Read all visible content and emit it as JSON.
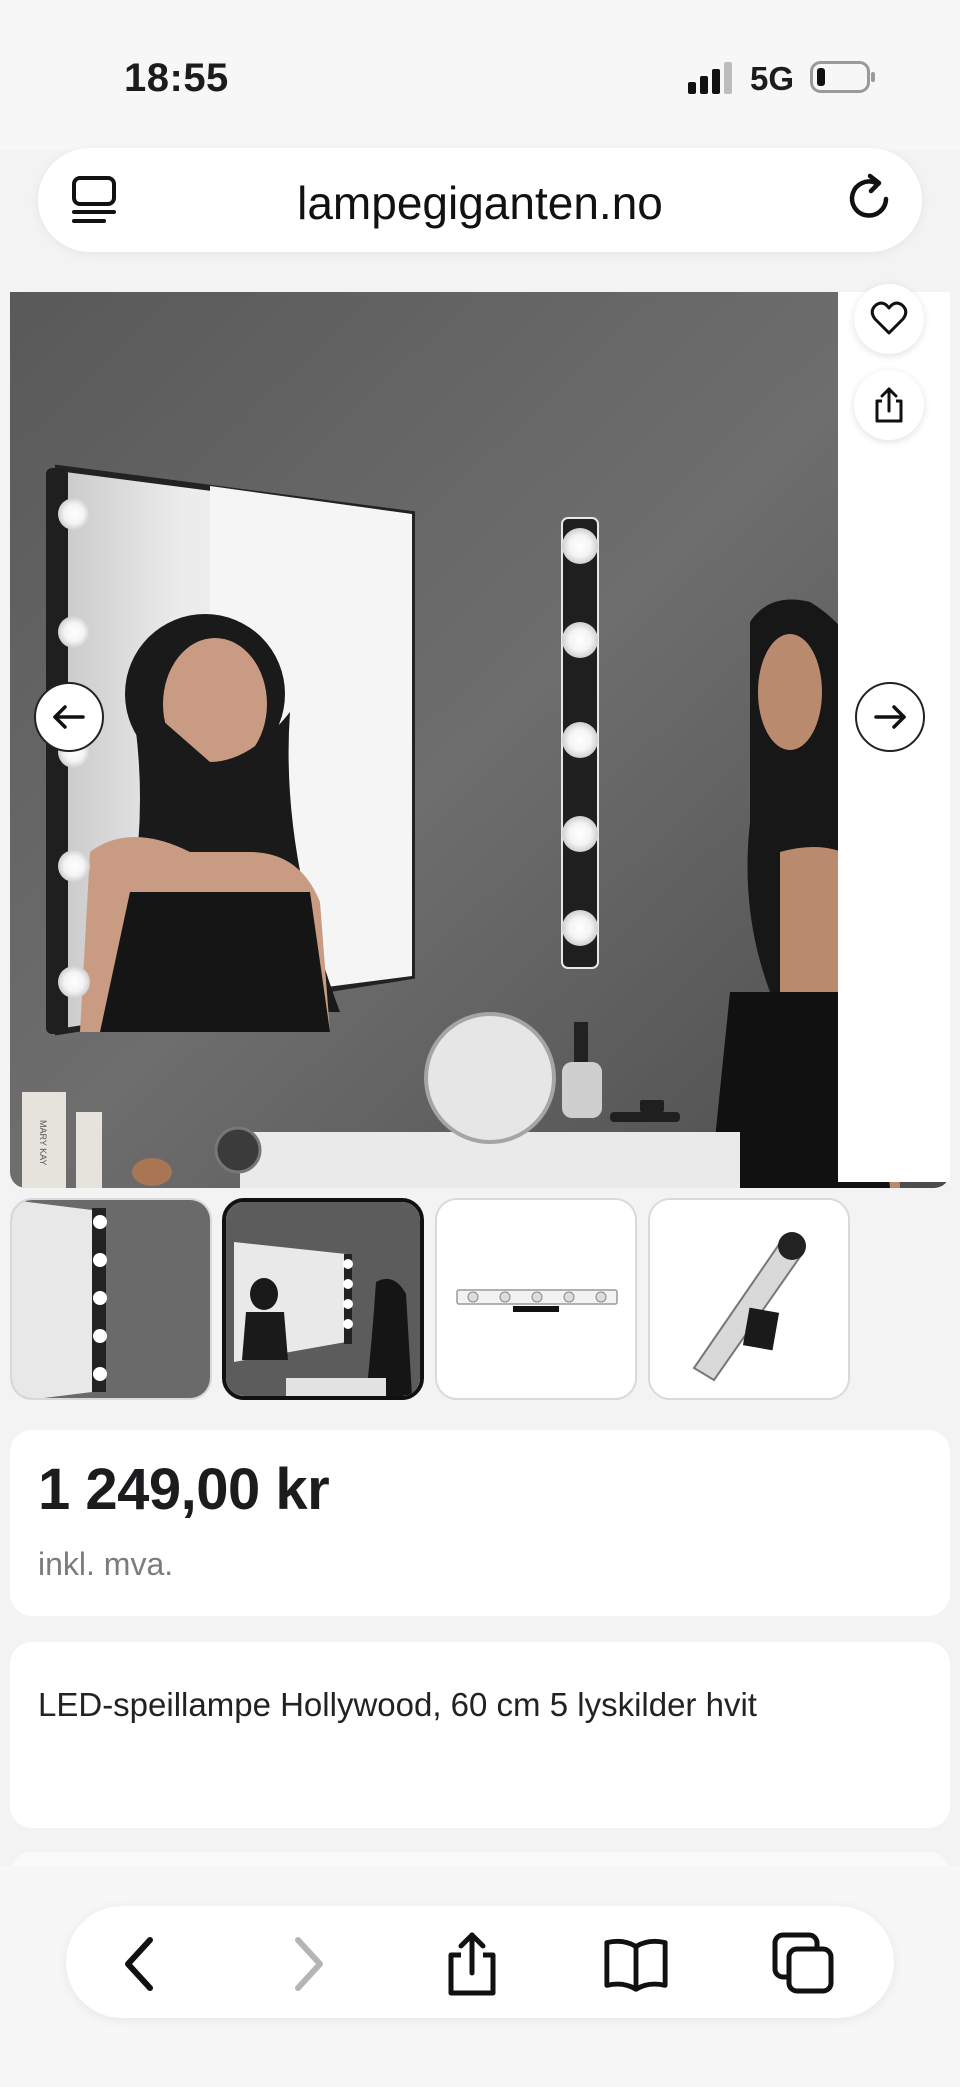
{
  "status": {
    "time": "18:55",
    "network": "5G"
  },
  "browser": {
    "url": "lampegiganten.no"
  },
  "icons": {
    "tabs": "tabs-list-icon",
    "reload": "reload-icon",
    "favorite": "heart-icon",
    "share": "share-icon",
    "prev": "arrow-left-icon",
    "next": "arrow-right-icon"
  },
  "gallery": {
    "thumbnails": [
      "thumbnail-1",
      "thumbnail-2",
      "thumbnail-3",
      "thumbnail-4"
    ],
    "selected_index": 2
  },
  "product": {
    "price": "1 249,00 kr",
    "vat_note": "inkl. mva.",
    "title": "LED-speillampe Hollywood, 60 cm 5 lyskilder hvit",
    "packaging_brand": "MARY KAY"
  },
  "toolbar": {
    "back": "chevron-left-icon",
    "forward": "chevron-right-icon",
    "share": "share-icon",
    "bookmarks": "book-icon",
    "tabs": "tabs-icon"
  },
  "colors": {
    "accent": "#111111",
    "muted": "#7b7b80",
    "background": "#f3f3f4"
  }
}
